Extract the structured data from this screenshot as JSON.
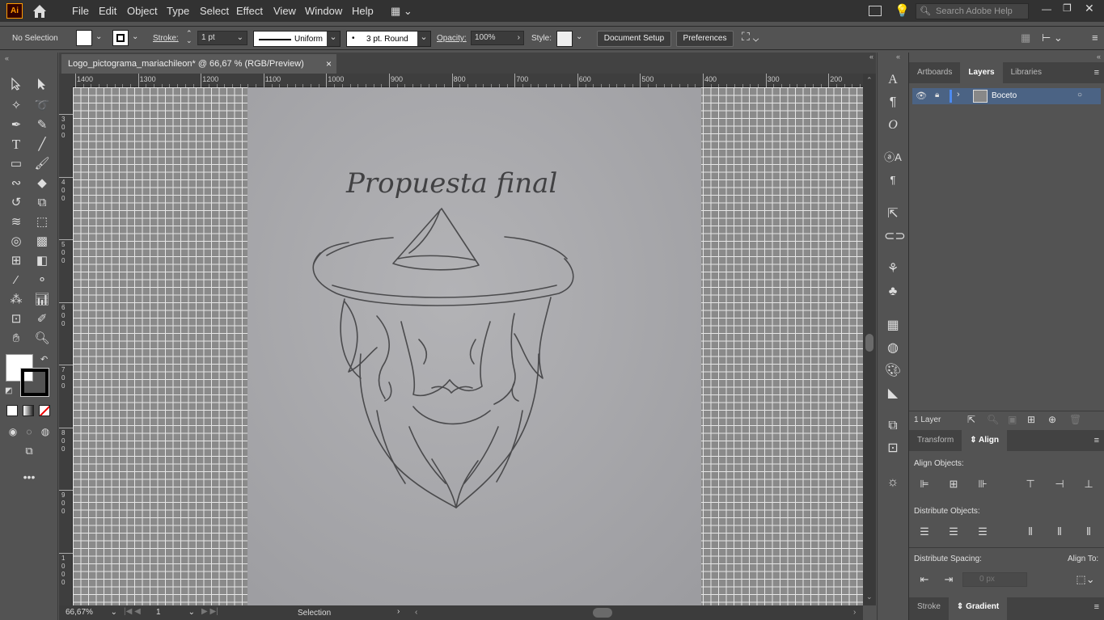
{
  "app": {
    "logo": "Ai",
    "search_placeholder": "Search Adobe Help"
  },
  "menu": [
    "File",
    "Edit",
    "Object",
    "Type",
    "Select",
    "Effect",
    "View",
    "Window",
    "Help"
  ],
  "control": {
    "selection": "No Selection",
    "stroke_label": "Stroke:",
    "stroke_weight": "1 pt",
    "profile": "Uniform",
    "brush": "3 pt. Round",
    "opacity_label": "Opacity:",
    "opacity": "100%",
    "style_label": "Style:",
    "document_setup": "Document Setup",
    "preferences": "Preferences"
  },
  "document": {
    "tab_title": "Logo_pictograma_mariachileon* @ 66,67 % (RGB/Preview)",
    "close": "×",
    "sketch_text": "Propuesta final"
  },
  "ruler": {
    "h_ticks": [
      "1400",
      "1300",
      "1200",
      "1100",
      "1000",
      "900",
      "800",
      "700",
      "600",
      "500",
      "400",
      "300",
      "200"
    ],
    "v_ticks": [
      "3\n0\n0",
      "4\n0\n0",
      "5\n0\n0",
      "6\n0\n0",
      "7\n0\n0",
      "8\n0\n0",
      "9\n0\n0",
      "1\n0\n0\n0"
    ]
  },
  "status": {
    "zoom": "66,67%",
    "artboard": "1",
    "tool": "Selection"
  },
  "panels": {
    "top_tabs": [
      "Artboards",
      "Layers",
      "Libraries"
    ],
    "layer_name": "Boceto",
    "layer_count": "1 Layer",
    "mid_tabs": [
      "Transform",
      "Align"
    ],
    "align_objects": "Align Objects:",
    "distribute_objects": "Distribute Objects:",
    "distribute_spacing": "Distribute Spacing:",
    "align_to": "Align To:",
    "spacing_value": "0 px",
    "bottom_tabs": [
      "Stroke",
      "Gradient"
    ]
  },
  "colors": {
    "accent": "#ff9a00",
    "layer_highlight": "#4b6384",
    "layer_color": "#4d8af0"
  }
}
